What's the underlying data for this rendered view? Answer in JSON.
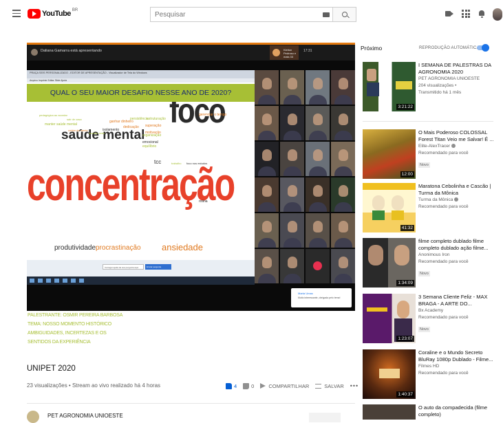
{
  "header": {
    "logo_text": "YouTube",
    "logo_country": "BR",
    "search_placeholder": "Pesquisar"
  },
  "player": {
    "presenter_text": "Daliana Gamarra está apresentando",
    "speaker_text": "Kleiton Pedroso e mais 33",
    "clock": "17:31",
    "slide": {
      "window_title": "PRAÇA SEIS PERSONALIZADO - EDITOR DE APRESENTAÇÃO - Visualizador de Tela do Windows",
      "toolbar_text": "Arquivo  Imprimir  Editar  Slide  Ajuda",
      "question": "QUAL O SEU MAIOR DESAFIO NESSE ANO DE 2020?",
      "footer_input": "Carregar ajuda de sua pergunta aqui",
      "footer_button": "Enviar pergunta",
      "words": [
        {
          "text": "concentração",
          "color": "#e8412a",
          "size": 50
        },
        {
          "text": "foco",
          "color": "#2b2b2b",
          "size": 42
        },
        {
          "text": "saúde mental",
          "color": "#2b2b2b",
          "size": 19
        },
        {
          "text": "produtividade",
          "color": "#2b2b2b",
          "size": 10
        },
        {
          "text": "procrastinação",
          "color": "#e0791f",
          "size": 10
        },
        {
          "text": "ansiedade",
          "color": "#e0791f",
          "size": 13
        },
        {
          "text": "tcc",
          "color": "#2b2b2b",
          "size": 8
        },
        {
          "text": "organização",
          "color": "#a7bf35",
          "size": 5
        },
        {
          "text": "motivação",
          "color": "#e0791f",
          "size": 5
        },
        {
          "text": "isolamento",
          "color": "#2b2b2b",
          "size": 5
        },
        {
          "text": "dedicação",
          "color": "#e0791f",
          "size": 5
        },
        {
          "text": "superação",
          "color": "#e0791f",
          "size": 5
        },
        {
          "text": "estruturação",
          "color": "#a7bf35",
          "size": 5
        },
        {
          "text": "ganhar dinheiro",
          "color": "#e0791f",
          "size": 5
        },
        {
          "text": "persistência",
          "color": "#a7bf35",
          "size": 5
        },
        {
          "text": "gerenciar o tempo",
          "color": "#e0791f",
          "size": 5
        },
        {
          "text": "lidar com o isolamento",
          "color": "#a7bf35",
          "size": 5
        },
        {
          "text": "manter saúde mental",
          "color": "#a7bf35",
          "size": 5
        },
        {
          "text": "interação social",
          "color": "#e0791f",
          "size": 5
        },
        {
          "text": "equilíbrio",
          "color": "#a7bf35",
          "size": 5
        },
        {
          "text": "ser melhor a cada dia",
          "color": "#a7bf35",
          "size": 5
        },
        {
          "text": "sair de casa",
          "color": "#a7bf35",
          "size": 4
        },
        {
          "text": "pedagógica ao acordar",
          "color": "#a7bf35",
          "size": 4
        },
        {
          "text": "rotina",
          "color": "#2b2b2b",
          "size": 5
        },
        {
          "text": "emocional",
          "color": "#2b2b2b",
          "size": 5
        },
        {
          "text": "acordar cedo",
          "color": "#a7bf35",
          "size": 4
        },
        {
          "text": "cuidar da mente",
          "color": "#e0791f",
          "size": 4
        },
        {
          "text": "trabalho",
          "color": "#a7bf35",
          "size": 4
        },
        {
          "text": "foco nos estudos",
          "color": "#2b2b2b",
          "size": 4
        }
      ]
    },
    "chat": {
      "name": "Marta Umas",
      "message": "Muito interessante, obrigada pelo tema!"
    }
  },
  "caption_lines": [
    "PALESTRANTE: OSMIR PEREIRA BARBOSA",
    "TEMA: NOSSO MOMENTO HISTÓRICO",
    "AMBIGUIDADES, INCERTEZAS E OS",
    "SENTIDOS DA EXPERIÊNCIA"
  ],
  "video": {
    "title": "UNIPET 2020",
    "meta": "23 visualizações • Stream ao vivo realizado há 4 horas",
    "likes": "4",
    "dislikes": "0",
    "share_label": "COMPARTILHAR",
    "save_label": "SALVAR",
    "more_label": "•••",
    "channel": "PET AGRONOMIA UNIOESTE"
  },
  "sidebar": {
    "heading": "Próximo",
    "autoplay_label": "REPRODUÇÃO AUTOMÁTICA",
    "autoplay_on": true,
    "items": [
      {
        "title": "I SEMANA DE PALESTRAS DA AGRONOMIA 2020",
        "channel": "PET AGRONOMIA UNIOESTE",
        "line2": "204 visualizações •",
        "line3": "Transmitido há 1 mês",
        "badge": "",
        "duration": "3:21:22",
        "verified": false
      },
      {
        "title": "O Mais Poderoso COLOSSAL Forest Titan Veio me Salvar! É ...",
        "channel": "Elite-AlexTracer",
        "line2": "Recomendado para você",
        "line3": "",
        "badge": "Novo",
        "duration": "12:00",
        "verified": true
      },
      {
        "title": "Maratona Cebolinha e Cascão | Turma da Mônica",
        "channel": "Turma da Mônica",
        "line2": "Recomendado para você",
        "line3": "",
        "badge": "",
        "duration": "41:32",
        "verified": true
      },
      {
        "title": "filme completo dublado filme completo dublado ação filme...",
        "channel": "Anonimous Iron",
        "line2": "Recomendado para você",
        "line3": "",
        "badge": "Novo",
        "duration": "1:34:09",
        "verified": false
      },
      {
        "title": "3 Semana Cliente Feliz - MAX BRAGA - A ARTE DO...",
        "channel": "Bx Academy",
        "line2": "Recomendado para você",
        "line3": "",
        "badge": "Novo",
        "duration": "1:23:07",
        "verified": false
      },
      {
        "title": "Coraline e o Mundo Secreto BluRay 1080p Dublado - Filme...",
        "channel": "Filmes HD",
        "line2": "Recomendado para você",
        "line3": "",
        "badge": "",
        "duration": "1:40:37",
        "verified": false
      },
      {
        "title": "O auto da compadecida (filme completo)",
        "channel": "",
        "line2": "",
        "line3": "",
        "badge": "",
        "duration": "",
        "verified": false
      }
    ]
  }
}
